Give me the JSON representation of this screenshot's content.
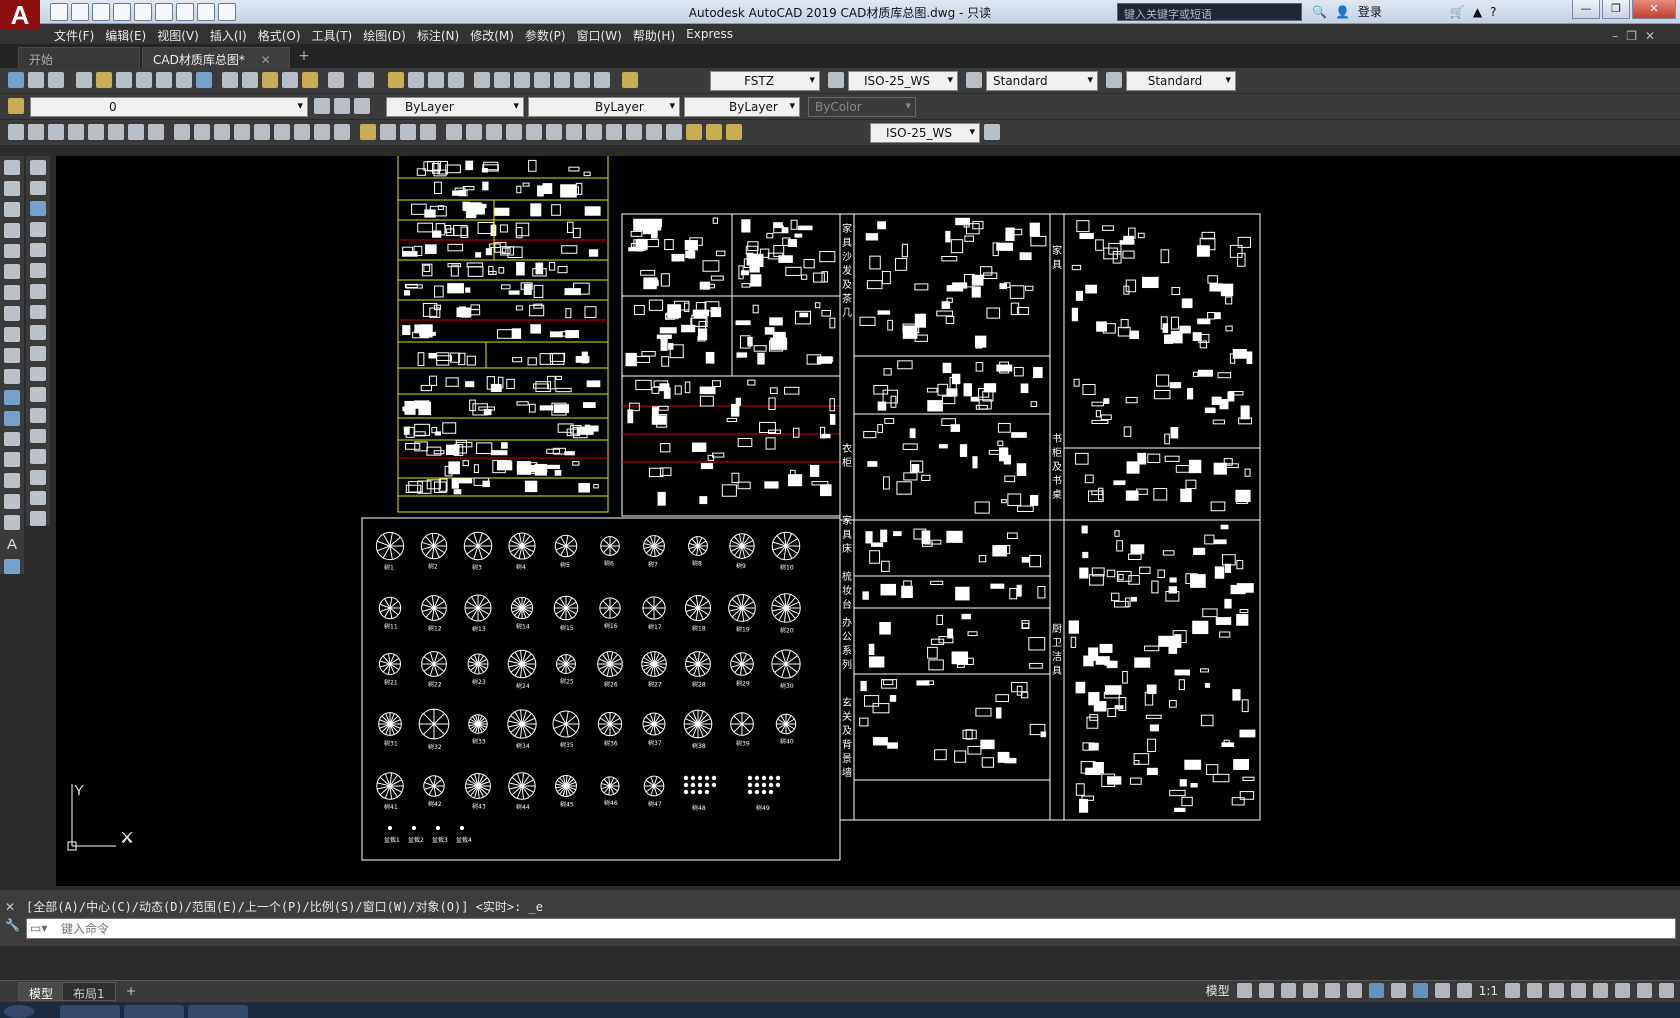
{
  "titlebar": {
    "title": "Autodesk AutoCAD 2019    CAD材质库总图.dwg - 只读",
    "search_placeholder": "键入关键字或短语",
    "login_label": "登录",
    "app_letter": "A"
  },
  "menu": [
    "文件(F)",
    "编辑(E)",
    "视图(V)",
    "插入(I)",
    "格式(O)",
    "工具(T)",
    "绘图(D)",
    "标注(N)",
    "修改(M)",
    "参数(P)",
    "窗口(W)",
    "帮助(H)",
    "Express"
  ],
  "tabs": {
    "start": "开始",
    "doc": "CAD材质库总图*",
    "close": "✕",
    "add": "+"
  },
  "toolbar": {
    "text_style": "FSTZ",
    "dim_style": "ISO-25_WS",
    "table_style": "Standard",
    "mleader_style": "Standard",
    "layer": "0",
    "color": "ByLayer",
    "linetype": "ByLayer",
    "lineweight": "ByLayer",
    "plotstyle": "ByColor",
    "dim_style_2": "ISO-25_WS"
  },
  "palette_text_icon": "A",
  "canvas": {
    "bg": "#000000",
    "ucs_x": "X",
    "ucs_y": "Y",
    "labels": {
      "sofa_group": "家具沙发及茶几",
      "wardrobe": "衣柜",
      "furniture_right": "家具",
      "bookcase": "书柜及书桌",
      "bed_group": "家具床",
      "dresser": "梳妆台",
      "office": "办公系列",
      "entrance": "玄关及背景墙",
      "kitchen": "厨卫洁具"
    },
    "tree_labels": [
      "树1",
      "树2",
      "树3",
      "树4",
      "树5",
      "树6",
      "树7",
      "树8",
      "树9",
      "树10",
      "树11",
      "树12",
      "树13",
      "树14",
      "树15",
      "树16",
      "树17",
      "树18",
      "树19",
      "树20",
      "树21",
      "树22",
      "树23",
      "树24",
      "树25",
      "树26",
      "树27",
      "树28",
      "树29",
      "树30",
      "树31",
      "树32",
      "树33",
      "树34",
      "树35",
      "树36",
      "树37",
      "树38",
      "树39",
      "树40",
      "树41",
      "树42",
      "树43",
      "树44",
      "树45",
      "树46",
      "树47",
      "树48",
      "树49"
    ],
    "shrub_labels": [
      "盆栽1",
      "盆栽2",
      "盆栽3",
      "盆栽4"
    ]
  },
  "command": {
    "history": "[全部(A)/中心(C)/动态(D)/范围(E)/上一个(P)/比例(S)/窗口(W)/对象(O)] <实时>: _e",
    "placeholder": "键入命令",
    "side_close": "✕",
    "side_tool": "🔧"
  },
  "statusbar": {
    "tab_model": "模型",
    "tab_layout1": "布局1",
    "tab_add": "+",
    "model_label": "模型",
    "scale": "1:1"
  }
}
